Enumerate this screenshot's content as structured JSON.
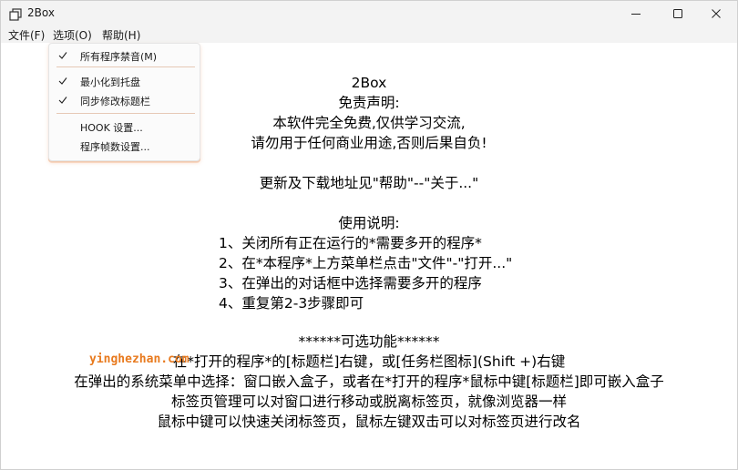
{
  "window": {
    "title": "2Box",
    "accent": "#e87a1e"
  },
  "menubar": {
    "file": "文件(F)",
    "options": "选项(O)",
    "help": "帮助(H)"
  },
  "options_menu": {
    "items": [
      {
        "label": "所有程序禁音(M)",
        "checked": true
      },
      {
        "label": "最小化到托盘",
        "checked": true
      },
      {
        "label": "同步修改标题栏",
        "checked": true
      },
      {
        "label": "HOOK 设置...",
        "checked": false
      },
      {
        "label": "程序帧数设置...",
        "checked": false
      }
    ]
  },
  "content": {
    "app_name": "2Box",
    "disclaimer_title": "免责声明:",
    "disclaimer_1": "本软件完全免费,仅供学习交流,",
    "disclaimer_2": "请勿用于任何商业用途,否则后果自负!",
    "update_note": "更新及下载地址见\"帮助\"--\"关于...\"",
    "usage_title": "使用说明:",
    "usage_steps": [
      "1、关闭所有正在运行的*需要多开的程序*",
      "2、在*本程序*上方菜单栏点击\"文件\"-\"打开...\"",
      "3、在弹出的对话框中选择需要多开的程序",
      "4、重复第2-3步骤即可"
    ],
    "optional_title": "******可选功能******",
    "optional_lines": [
      "在*打开的程序*的[标题栏]右键，或[任务栏图标](Shift +)右键",
      "在弹出的系统菜单中选择：窗口嵌入盒子，或者在*打开的程序*鼠标中键[标题栏]即可嵌入盒子",
      "标签页管理可以对窗口进行移动或脱离标签页，就像浏览器一样",
      "鼠标中键可以快速关闭标签页，鼠标左键双击可以对标签页进行改名"
    ]
  },
  "watermark": "yinghezhan.com"
}
